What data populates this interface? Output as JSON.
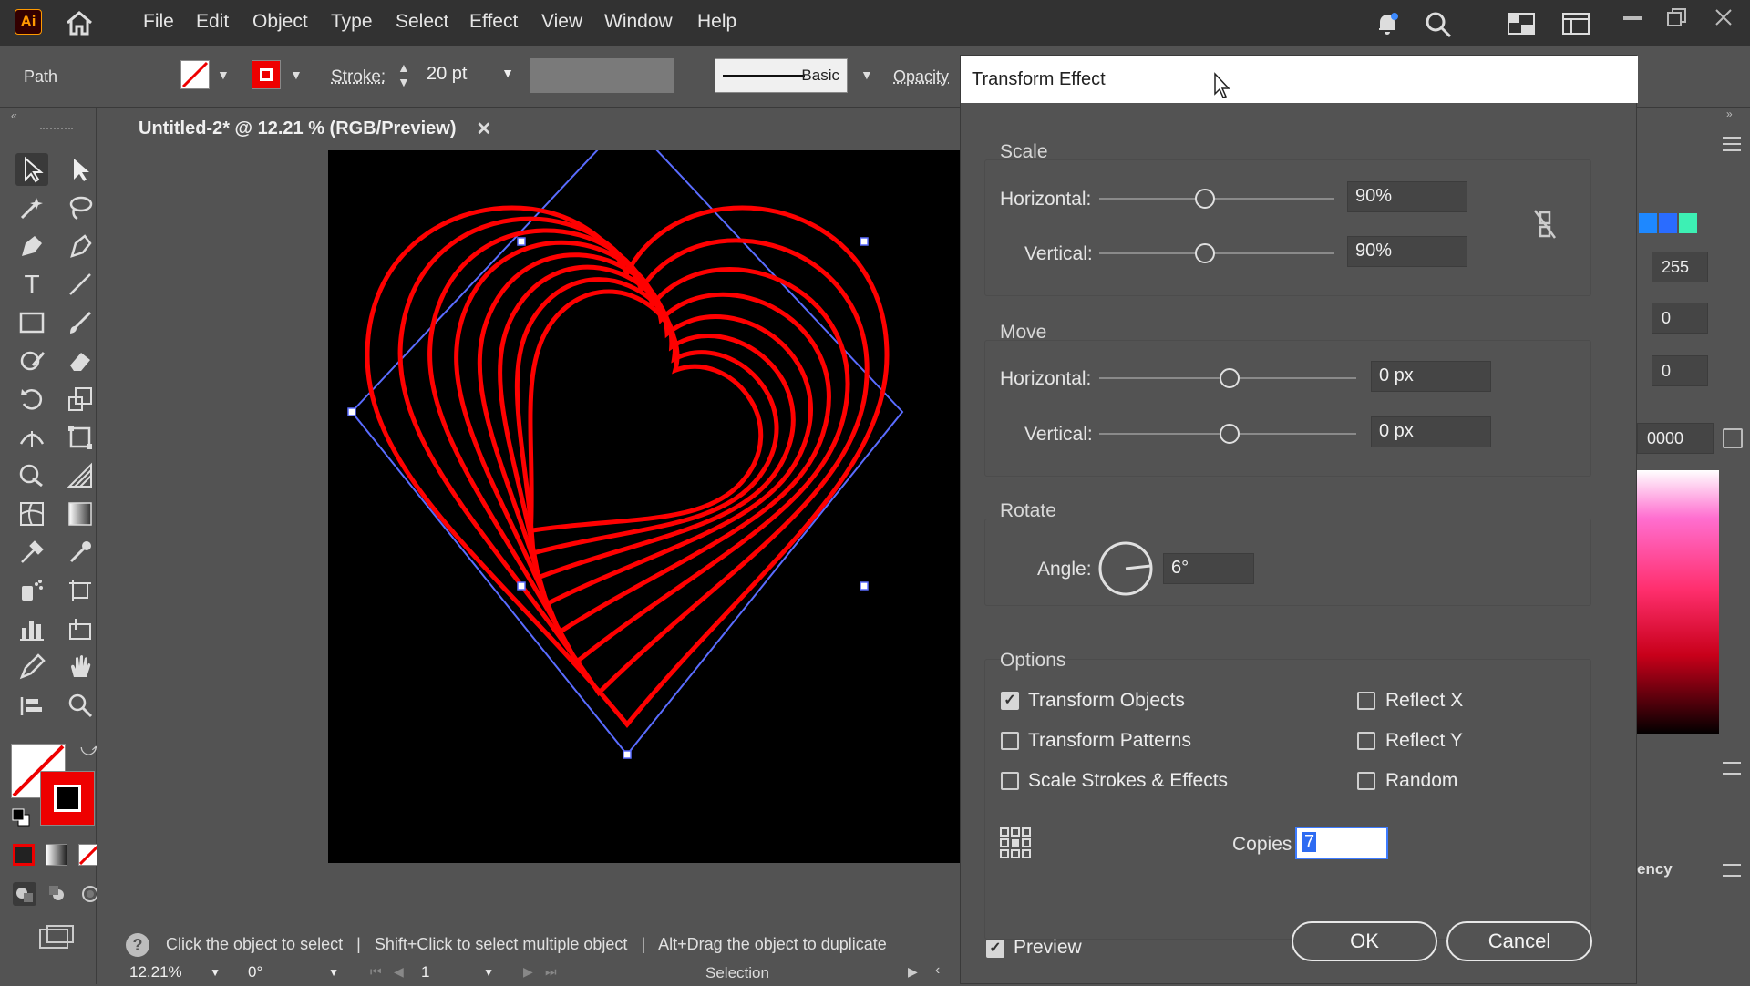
{
  "app": {
    "logo": "Ai"
  },
  "menu": [
    "File",
    "Edit",
    "Object",
    "Type",
    "Select",
    "Effect",
    "View",
    "Window",
    "Help"
  ],
  "control": {
    "selection_label": "Path",
    "stroke_label": "Stroke:",
    "stroke_value": "20 pt",
    "brush_label": "Basic",
    "opacity_label": "Opacity"
  },
  "document": {
    "tab_title": "Untitled-2* @ 12.21 % (RGB/Preview)",
    "stroke_color": "#ff0000"
  },
  "status": {
    "tip_parts": [
      "Click the object to select",
      "Shift+Click to select multiple object",
      "Alt+Drag the object to duplicate"
    ],
    "zoom": "12.21%",
    "rotation": "0°",
    "artboard": "1",
    "mode": "Selection"
  },
  "dialog": {
    "title": "Transform Effect",
    "scale": {
      "title": "Scale",
      "horizontal_label": "Horizontal:",
      "horizontal_value": "90%",
      "vertical_label": "Vertical:",
      "vertical_value": "90%"
    },
    "move": {
      "title": "Move",
      "horizontal_label": "Horizontal:",
      "horizontal_value": "0 px",
      "vertical_label": "Vertical:",
      "vertical_value": "0 px"
    },
    "rotate": {
      "title": "Rotate",
      "angle_label": "Angle:",
      "angle_value": "6°"
    },
    "options": {
      "title": "Options",
      "transform_objects": "Transform Objects",
      "transform_patterns": "Transform Patterns",
      "scale_strokes": "Scale Strokes & Effects",
      "reflect_x": "Reflect X",
      "reflect_y": "Reflect Y",
      "random": "Random"
    },
    "copies_label": "Copies",
    "copies_value": "7",
    "preview_label": "Preview",
    "ok_label": "OK",
    "cancel_label": "Cancel"
  },
  "right_panel": {
    "values": [
      "255",
      "0",
      "0"
    ],
    "hex_partial": "0000",
    "tab_partial": "ency",
    "swatch_colors": [
      "#1e88ff",
      "#2a6cff",
      "#3df0b4"
    ]
  }
}
